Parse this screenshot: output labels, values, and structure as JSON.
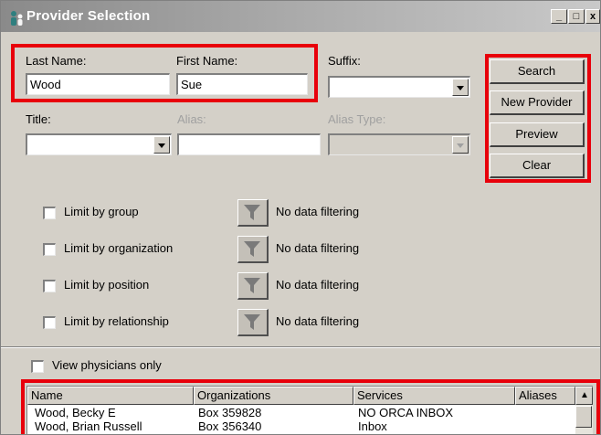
{
  "window": {
    "title": "Provider Selection",
    "minimize": "_",
    "maximize": "□",
    "close": "x"
  },
  "form": {
    "last_name_label": "Last Name:",
    "last_name_value": "Wood",
    "first_name_label": "First Name:",
    "first_name_value": "Sue",
    "suffix_label": "Suffix:",
    "suffix_value": "",
    "title_label": "Title:",
    "title_value": "",
    "alias_label": "Alias:",
    "alias_value": "",
    "alias_type_label": "Alias Type:",
    "alias_type_value": ""
  },
  "buttons": {
    "search": "Search",
    "new_provider": "New Provider",
    "preview": "Preview",
    "clear": "Clear"
  },
  "limits": [
    {
      "label": "Limit by group",
      "filter_text": "No data filtering",
      "checked": false
    },
    {
      "label": "Limit by organization",
      "filter_text": "No data filtering",
      "checked": false
    },
    {
      "label": "Limit by position",
      "filter_text": "No data filtering",
      "checked": false
    },
    {
      "label": "Limit by relationship",
      "filter_text": "No data filtering",
      "checked": false
    }
  ],
  "physicians_only_label": "View physicians only",
  "results": {
    "columns": [
      "Name",
      "Organizations",
      "Services",
      "Aliases"
    ],
    "sort_arrow": "▲",
    "rows": [
      [
        "Wood, Becky E",
        "Box 359828",
        "NO ORCA INBOX",
        ""
      ],
      [
        "Wood, Brian Russell",
        "Box 356340",
        "Inbox",
        ""
      ]
    ]
  },
  "colors": {
    "highlight_red": "#e8000b",
    "title_gradient_start": "#8a8a8a",
    "window_face": "#d4d0c8"
  },
  "icons": {
    "title": "provider-people-icon",
    "filter": "funnel-icon",
    "dropdown": "chevron-down-icon"
  }
}
